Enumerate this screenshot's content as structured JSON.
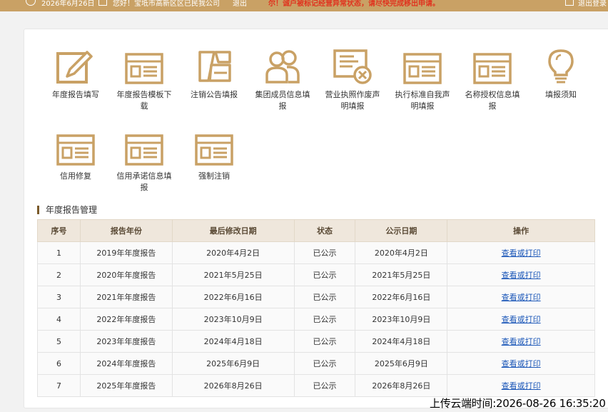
{
  "topbar": {
    "date": "2026年6月26日",
    "greeting": "您好！宝坻市高新区区已民我公司",
    "logout_short": "退出",
    "warning": "尔！诚户被标记经营异常状态，请尽快完成移出申请。",
    "logout": "退出登录"
  },
  "tools": [
    {
      "icon": "pen-icon",
      "label": "年度报告填写"
    },
    {
      "icon": "form-icon",
      "label": "年度报告模板下载"
    },
    {
      "icon": "cancel-notice-icon",
      "label": "注销公告填报"
    },
    {
      "icon": "group-members-icon",
      "label": "集团成员信息填报"
    },
    {
      "icon": "license-void-icon",
      "label": "营业执照作废声明填报"
    },
    {
      "icon": "form-icon",
      "label": "执行标准自我声明填报"
    },
    {
      "icon": "form-icon",
      "label": "名称授权信息填报"
    },
    {
      "icon": "lightbulb-icon",
      "label": "填报须知"
    },
    {
      "icon": "form-icon",
      "label": "信用修复"
    },
    {
      "icon": "form-icon",
      "label": "信用承诺信息填报"
    },
    {
      "icon": "form-icon",
      "label": "强制注销"
    }
  ],
  "section": {
    "title": "年度报告管理"
  },
  "table": {
    "headers": [
      "序号",
      "报告年份",
      "最后修改日期",
      "状态",
      "公示日期",
      "操作"
    ],
    "rows": [
      [
        "1",
        "2019年年度报告",
        "2020年4月2日",
        "已公示",
        "2020年4月2日",
        "查看或打印"
      ],
      [
        "2",
        "2020年年度报告",
        "2021年5月25日",
        "已公示",
        "2021年5月25日",
        "查看或打印"
      ],
      [
        "3",
        "2021年年度报告",
        "2022年6月16日",
        "已公示",
        "2022年6月16日",
        "查看或打印"
      ],
      [
        "4",
        "2022年年度报告",
        "2023年10月9日",
        "已公示",
        "2023年10月9日",
        "查看或打印"
      ],
      [
        "5",
        "2023年年度报告",
        "2024年4月18日",
        "已公示",
        "2024年4月18日",
        "查看或打印"
      ],
      [
        "6",
        "2024年年度报告",
        "2025年6月9日",
        "已公示",
        "2025年6月9日",
        "查看或打印"
      ],
      [
        "7",
        "2025年年度报告",
        "2026年8月26日",
        "已公示",
        "2026年8月26日",
        "查看或打印"
      ]
    ]
  },
  "upload_stamp": "上传云端时间:2026-08-26 16:35:20",
  "colors": {
    "accent": "#c9a165",
    "link": "#1a56b8"
  }
}
